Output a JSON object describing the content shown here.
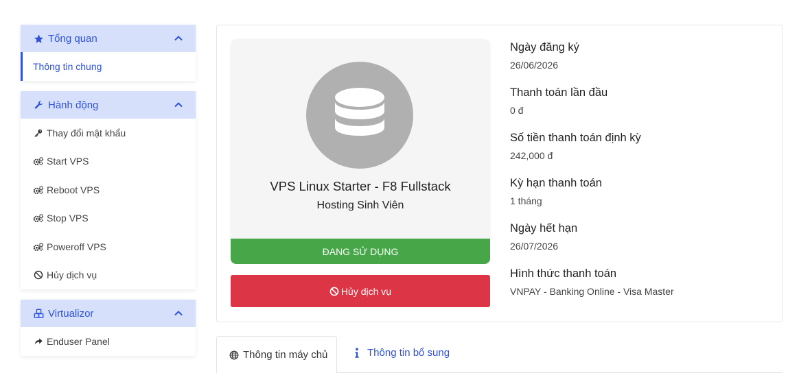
{
  "sidebar": {
    "overview": {
      "title": "Tổng quan",
      "items": [
        "Thông tin chung"
      ]
    },
    "actions": {
      "title": "Hành động",
      "items": [
        "Thay đổi mật khẩu",
        "Start VPS",
        "Reboot VPS",
        "Stop VPS",
        "Poweroff VPS",
        "Hủy dịch vụ"
      ]
    },
    "virtualizor": {
      "title": "Virtualizor",
      "items": [
        "Enduser Panel"
      ]
    }
  },
  "product": {
    "name": "VPS Linux Starter - F8 Fullstack",
    "group": "Hosting Sinh Viên",
    "status": "ĐANG SỬ DỤNG",
    "cancel_label": "Hủy dịch vụ"
  },
  "info": [
    {
      "label": "Ngày đăng ký",
      "value": "26/06/2026"
    },
    {
      "label": "Thanh toán lần đầu",
      "value": "0 đ"
    },
    {
      "label": "Số tiền thanh toán định kỳ",
      "value": "242,000 đ"
    },
    {
      "label": "Kỳ hạn thanh toán",
      "value": "1 tháng"
    },
    {
      "label": "Ngày hết hạn",
      "value": "26/07/2026"
    },
    {
      "label": "Hình thức thanh toán",
      "value": "VNPAY - Banking Online - Visa Master"
    }
  ],
  "tabs": [
    "Thông tin máy chủ",
    "Thông tin bổ sung"
  ],
  "colors": {
    "accent": "#2f52d8",
    "header_bg": "#d6e0fb",
    "success": "#46a648",
    "danger": "#dc3545"
  }
}
